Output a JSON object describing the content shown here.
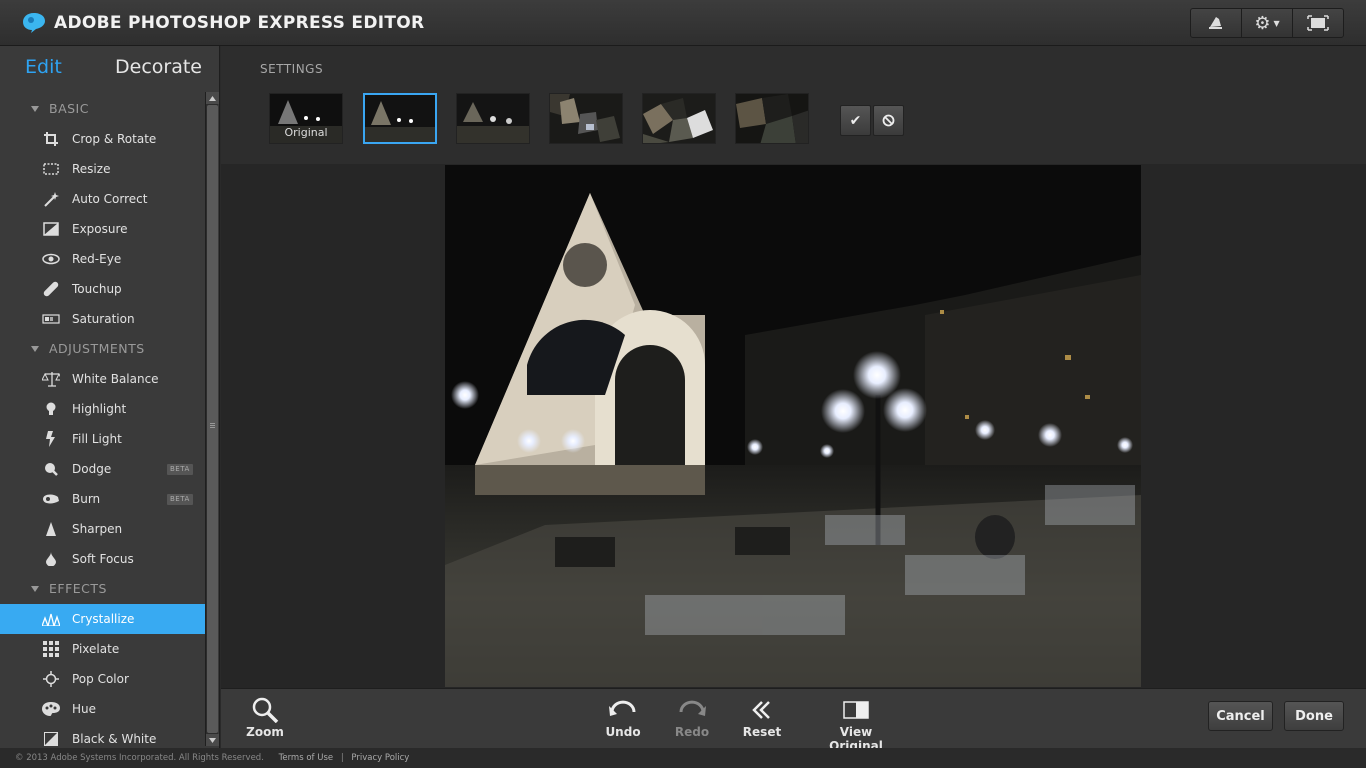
{
  "app": {
    "title": "ADOBE PHOTOSHOP EXPRESS EDITOR",
    "accent_color": "#38aaf2"
  },
  "header_buttons": [
    {
      "icon": "bell-icon"
    },
    {
      "icon": "gear-icon"
    },
    {
      "icon": "fullscreen-icon"
    }
  ],
  "mode_tabs": {
    "edit": "Edit",
    "decorate": "Decorate",
    "selected": "Edit"
  },
  "sidebar": {
    "sections": [
      {
        "title": "BASIC",
        "tools": [
          {
            "label": "Crop & Rotate",
            "icon": "crop-icon"
          },
          {
            "label": "Resize",
            "icon": "resize-icon"
          },
          {
            "label": "Auto Correct",
            "icon": "magic-wand-icon"
          },
          {
            "label": "Exposure",
            "icon": "exposure-icon"
          },
          {
            "label": "Red-Eye",
            "icon": "eye-icon"
          },
          {
            "label": "Touchup",
            "icon": "bandage-icon"
          },
          {
            "label": "Saturation",
            "icon": "saturation-icon"
          }
        ]
      },
      {
        "title": "ADJUSTMENTS",
        "tools": [
          {
            "label": "White Balance",
            "icon": "scales-icon"
          },
          {
            "label": "Highlight",
            "icon": "bulb-icon"
          },
          {
            "label": "Fill Light",
            "icon": "lightning-icon"
          },
          {
            "label": "Dodge",
            "icon": "dodge-icon",
            "badge": "BETA"
          },
          {
            "label": "Burn",
            "icon": "burn-icon",
            "badge": "BETA"
          },
          {
            "label": "Sharpen",
            "icon": "sharpen-icon"
          },
          {
            "label": "Soft Focus",
            "icon": "drop-icon"
          }
        ]
      },
      {
        "title": "EFFECTS",
        "tools": [
          {
            "label": "Crystallize",
            "icon": "crystallize-icon",
            "active": true
          },
          {
            "label": "Pixelate",
            "icon": "pixelate-icon"
          },
          {
            "label": "Pop Color",
            "icon": "pop-color-icon"
          },
          {
            "label": "Hue",
            "icon": "palette-icon"
          },
          {
            "label": "Black & White",
            "icon": "black-white-icon"
          }
        ]
      }
    ]
  },
  "settings": {
    "label": "SETTINGS",
    "thumbnails": [
      {
        "caption": "Original",
        "selected": false
      },
      {
        "caption": "",
        "selected": true
      },
      {
        "caption": "",
        "selected": false
      },
      {
        "caption": "",
        "selected": false
      },
      {
        "caption": "",
        "selected": false
      },
      {
        "caption": "",
        "selected": false
      }
    ],
    "confirm_icon": "checkmark-icon",
    "cancel_icon": "cancel-circle-icon"
  },
  "toolbar": {
    "zoom": "Zoom",
    "undo": "Undo",
    "redo": "Redo",
    "reset": "Reset",
    "view_original": "View Original",
    "cancel": "Cancel",
    "done": "Done"
  },
  "footer": {
    "copyright": "© 2013 Adobe Systems Incorporated. All Rights Reserved.",
    "terms": "Terms of Use",
    "separator": "|",
    "privacy": "Privacy Policy"
  }
}
